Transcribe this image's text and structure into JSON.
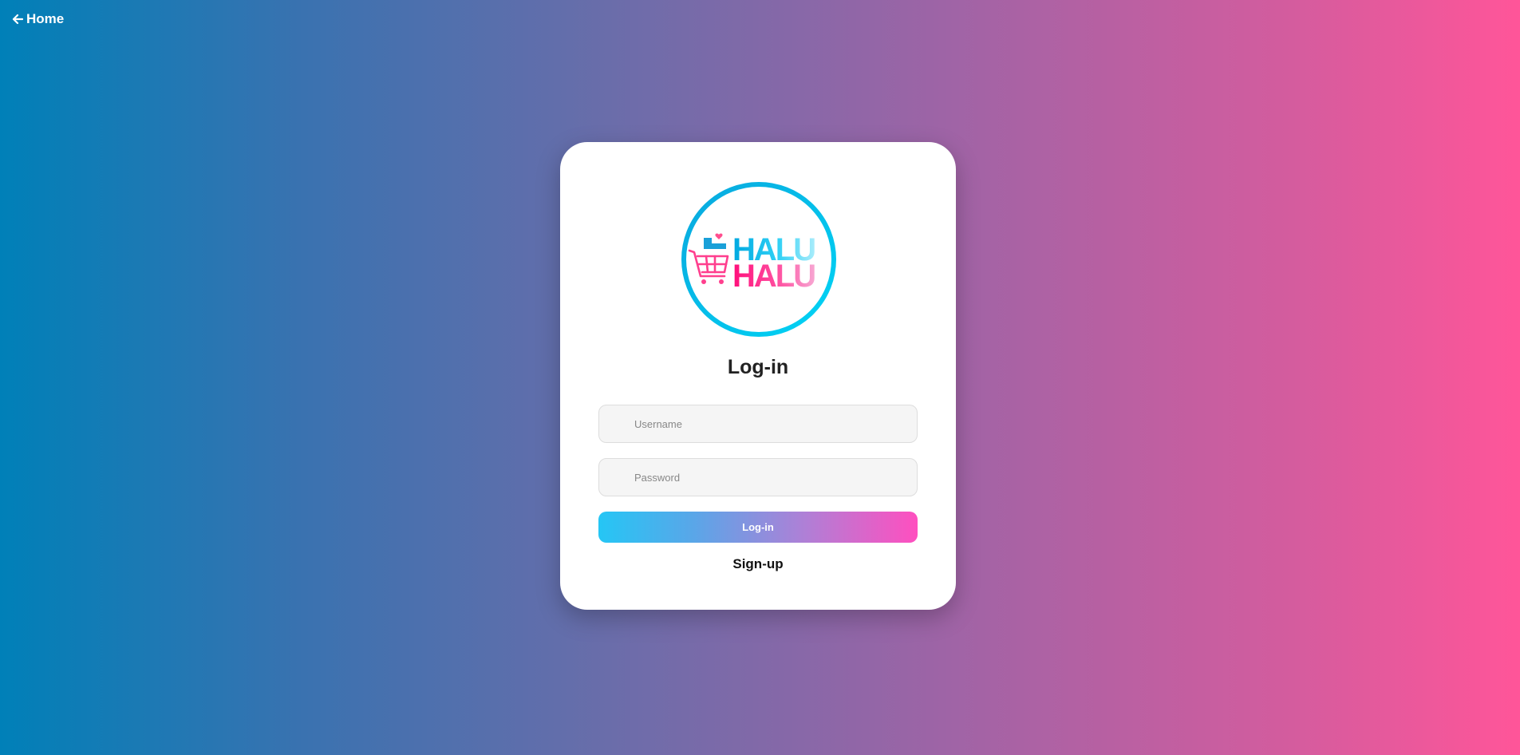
{
  "nav": {
    "home_label": "Home",
    "home_icon": "arrow-left-icon"
  },
  "logo": {
    "line1": "HALU",
    "line2": "HALU",
    "ring_color": "#00c8f0",
    "brand_pink": "#ff1f8a",
    "brand_cyan": "#00b8e8"
  },
  "form": {
    "title": "Log-in",
    "username_placeholder": "Username",
    "password_placeholder": "Password",
    "login_button_label": "Log-in",
    "signup_label": "Sign-up"
  },
  "colors": {
    "bg_left": "#0080b8",
    "bg_right": "#ff5599",
    "button_left": "#25c6f5",
    "button_right": "#ff4fbf"
  }
}
